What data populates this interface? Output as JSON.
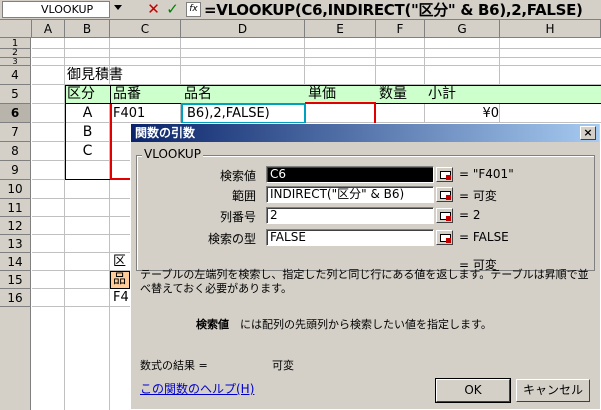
{
  "formula_bar": {
    "name_box": "VLOOKUP",
    "cancel": "✕",
    "enter": "✓",
    "fx": "fx",
    "formula": "=VLOOKUP(C6,INDIRECT(\"区分\" & B6),2,FALSE)"
  },
  "sheet": {
    "columns": [
      "A",
      "B",
      "C",
      "D",
      "E",
      "F",
      "G",
      "H"
    ],
    "rows": [
      "1",
      "2",
      "3",
      "4",
      "5",
      "6",
      "7",
      "8",
      "9",
      "10",
      "11",
      "12",
      "13",
      "14",
      "15",
      "16"
    ],
    "title": "御見積書",
    "headers": [
      "区分",
      "品番",
      "品名",
      "単価",
      "数量",
      "小計"
    ],
    "row6": {
      "kubun": "A",
      "hinban": "F401",
      "hinmei": "B6),2,FALSE)",
      "shokei": "¥0"
    },
    "row7": {
      "kubun": "B"
    },
    "row8": {
      "kubun": "C"
    },
    "c14": "区",
    "c15": "品",
    "c16": "F4"
  },
  "dialog": {
    "title": "関数の引数",
    "close": "×",
    "group": "VLOOKUP",
    "args": [
      {
        "label": "検索値",
        "value": "C6",
        "result": "= \"F401\""
      },
      {
        "label": "範囲",
        "value": "INDIRECT(\"区分\" & B6)",
        "result": "= 可変"
      },
      {
        "label": "列番号",
        "value": "2",
        "result": "= 2"
      },
      {
        "label": "検索の型",
        "value": "FALSE",
        "result": "= FALSE"
      }
    ],
    "total_result": "= 可変",
    "description": "テーブルの左端列を検索し、指定した列と同じ行にある値を返します。テーブルは昇順で並べ替えておく必要があります。",
    "arg_help_name": "検索値",
    "arg_help_text": "には配列の先頭列から検索したい値を指定します。",
    "formula_result_label": "数式の結果 =",
    "formula_result_value": "可変",
    "help_link": "この関数のヘルプ(H)",
    "ok": "OK",
    "cancel": "キャンセル"
  }
}
